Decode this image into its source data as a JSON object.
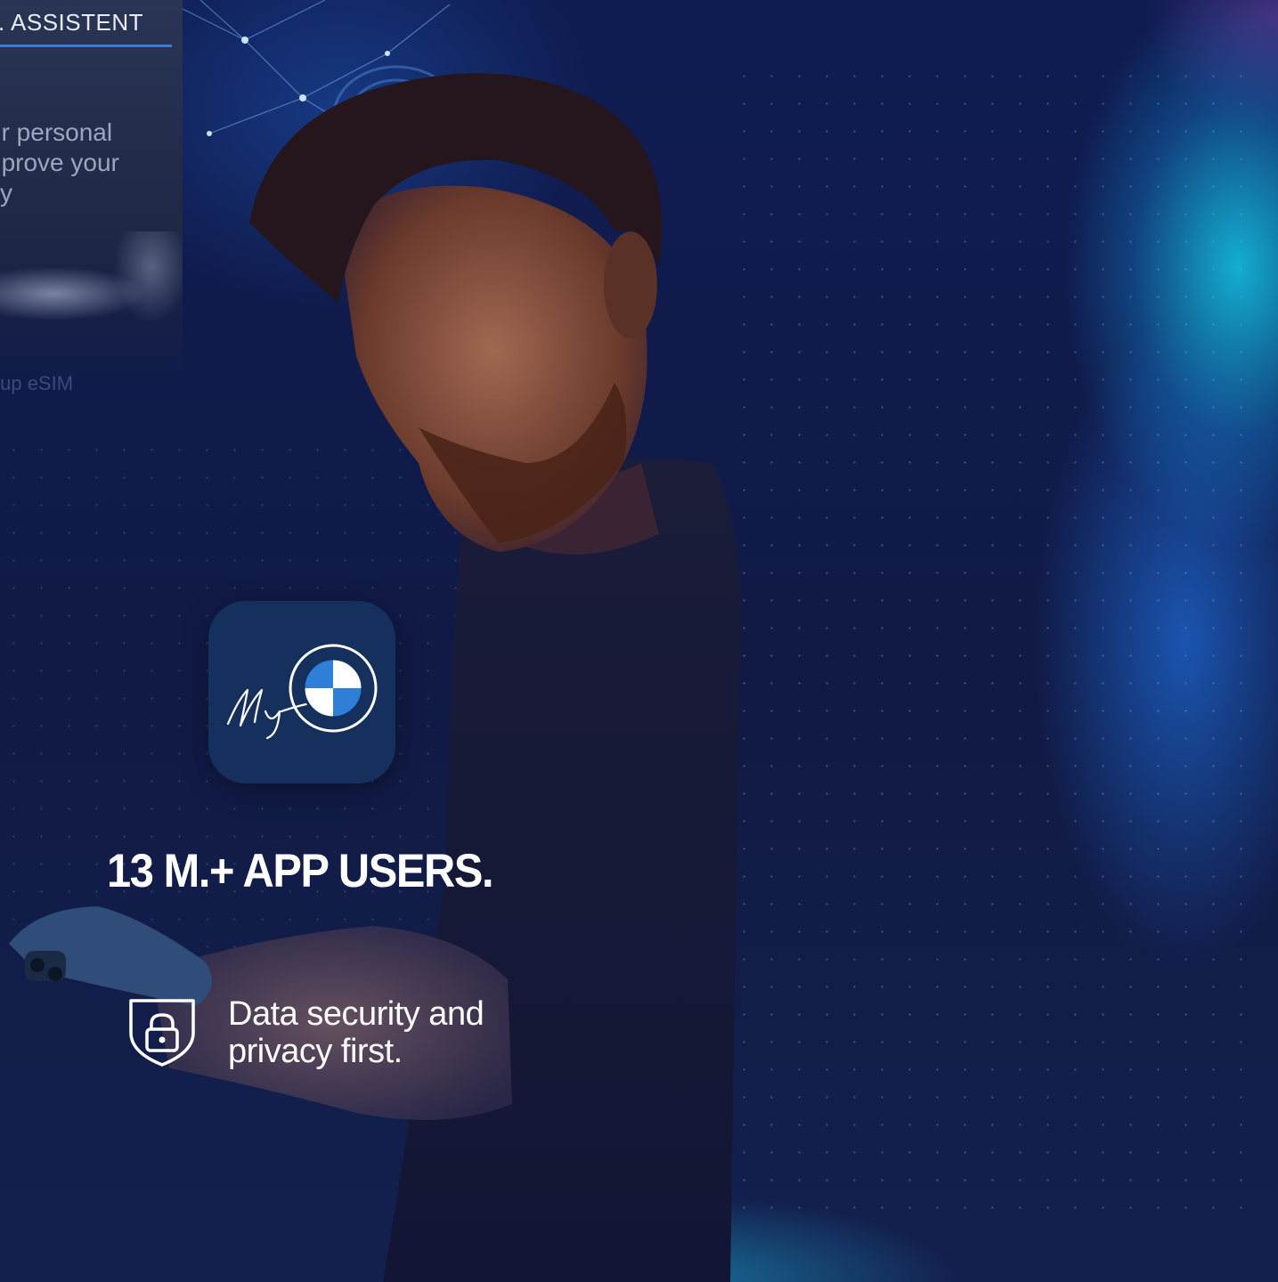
{
  "background_screen": {
    "title": ". ASSISTENT",
    "body_lines": [
      "ur personal",
      "nprove your",
      "ity"
    ],
    "link": "tup eSIM"
  },
  "app_icon": {
    "name": "my-bmw-app-icon",
    "script_text": "My",
    "logo_letters": [
      "B",
      "M",
      "W"
    ]
  },
  "headline": "13 M.+ APP USERS.",
  "security": {
    "icon": "shield-lock-icon",
    "line1": "Data security and",
    "line2": "privacy first."
  },
  "colors": {
    "background": "#111a45",
    "tile": "#16305e",
    "bmw_blue": "#2f7ed8",
    "accent_line": "#3b7ad6"
  }
}
